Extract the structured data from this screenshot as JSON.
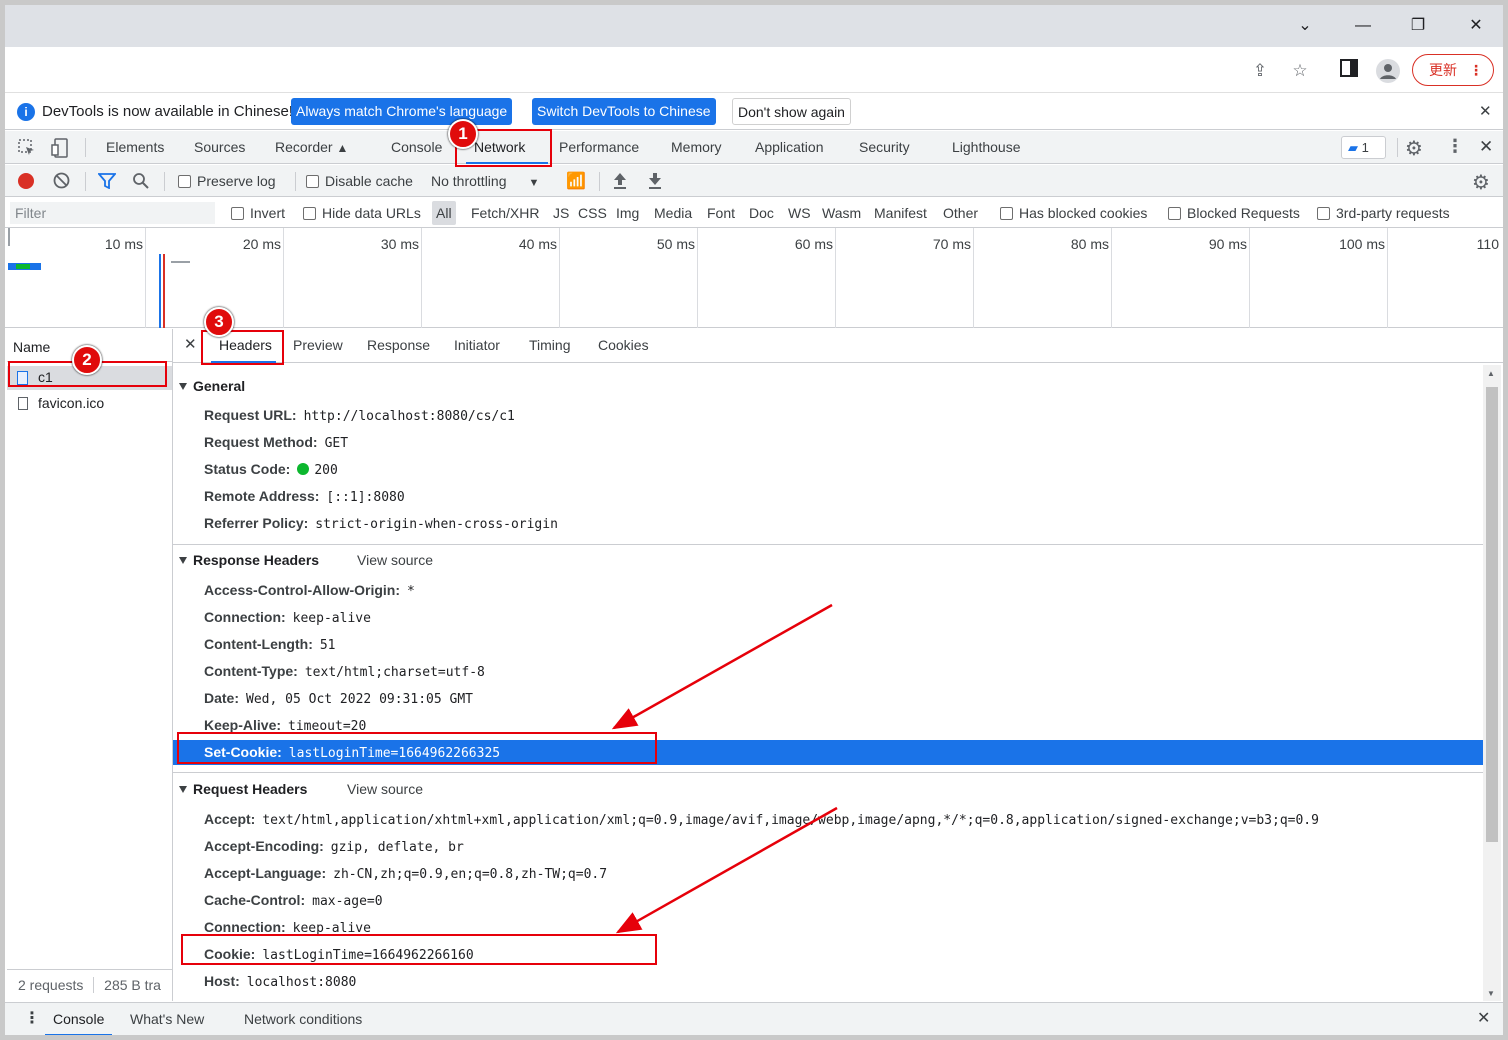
{
  "infobar": {
    "message": "DevTools is now available in Chinese!",
    "btn_match": "Always match Chrome's language",
    "btn_switch": "Switch DevTools to Chinese",
    "btn_dont": "Don't show again"
  },
  "toolbar": {
    "update_label": "更新"
  },
  "tabs": [
    "Elements",
    "Sources",
    "Recorder",
    "Console",
    "Network",
    "Performance",
    "Memory",
    "Application",
    "Security",
    "Lighthouse"
  ],
  "issues_count": "1",
  "netbar": {
    "preserve_log": "Preserve log",
    "disable_cache": "Disable cache",
    "throttling": "No throttling"
  },
  "filterbar": {
    "placeholder": "Filter",
    "invert": "Invert",
    "hide_data_urls": "Hide data URLs",
    "types": [
      "All",
      "Fetch/XHR",
      "JS",
      "CSS",
      "Img",
      "Media",
      "Font",
      "Doc",
      "WS",
      "Wasm",
      "Manifest",
      "Other"
    ],
    "blocked_cookies": "Has blocked cookies",
    "blocked_requests": "Blocked Requests",
    "third_party": "3rd-party requests"
  },
  "timeline_ticks": [
    "10 ms",
    "20 ms",
    "30 ms",
    "40 ms",
    "50 ms",
    "60 ms",
    "70 ms",
    "80 ms",
    "90 ms",
    "100 ms",
    "110"
  ],
  "requests": {
    "header": "Name",
    "items": [
      "c1",
      "favicon.ico"
    ],
    "status": "2 requests",
    "transferred": "285 B tra"
  },
  "detail_tabs": [
    "Headers",
    "Preview",
    "Response",
    "Initiator",
    "Timing",
    "Cookies"
  ],
  "general": {
    "title": "General",
    "rows": [
      {
        "k": "Request URL:",
        "v": "http://localhost:8080/cs/c1"
      },
      {
        "k": "Request Method:",
        "v": "GET"
      },
      {
        "k": "Status Code:",
        "v": "200"
      },
      {
        "k": "Remote Address:",
        "v": "[::1]:8080"
      },
      {
        "k": "Referrer Policy:",
        "v": "strict-origin-when-cross-origin"
      }
    ]
  },
  "response_headers": {
    "title": "Response Headers",
    "view_source": "View source",
    "rows": [
      {
        "k": "Access-Control-Allow-Origin:",
        "v": "*"
      },
      {
        "k": "Connection:",
        "v": "keep-alive"
      },
      {
        "k": "Content-Length:",
        "v": "51"
      },
      {
        "k": "Content-Type:",
        "v": "text/html;charset=utf-8"
      },
      {
        "k": "Date:",
        "v": "Wed, 05 Oct 2022 09:31:05 GMT"
      },
      {
        "k": "Keep-Alive:",
        "v": "timeout=20"
      },
      {
        "k": "Set-Cookie:",
        "v": "lastLoginTime=1664962266325"
      }
    ]
  },
  "request_headers": {
    "title": "Request Headers",
    "view_source": "View source",
    "rows": [
      {
        "k": "Accept:",
        "v": "text/html,application/xhtml+xml,application/xml;q=0.9,image/avif,image/webp,image/apng,*/*;q=0.8,application/signed-exchange;v=b3;q=0.9"
      },
      {
        "k": "Accept-Encoding:",
        "v": "gzip, deflate, br"
      },
      {
        "k": "Accept-Language:",
        "v": "zh-CN,zh;q=0.9,en;q=0.8,zh-TW;q=0.7"
      },
      {
        "k": "Cache-Control:",
        "v": "max-age=0"
      },
      {
        "k": "Connection:",
        "v": "keep-alive"
      },
      {
        "k": "Cookie:",
        "v": "lastLoginTime=1664962266160"
      },
      {
        "k": "Host:",
        "v": "localhost:8080"
      }
    ]
  },
  "drawer_tabs": [
    "Console",
    "What's New",
    "Network conditions"
  ],
  "annotations": [
    "1",
    "2",
    "3"
  ],
  "colors": {
    "accent": "#1a73e8",
    "annotation_red": "#e6000a",
    "status_green": "#0cb72e"
  }
}
